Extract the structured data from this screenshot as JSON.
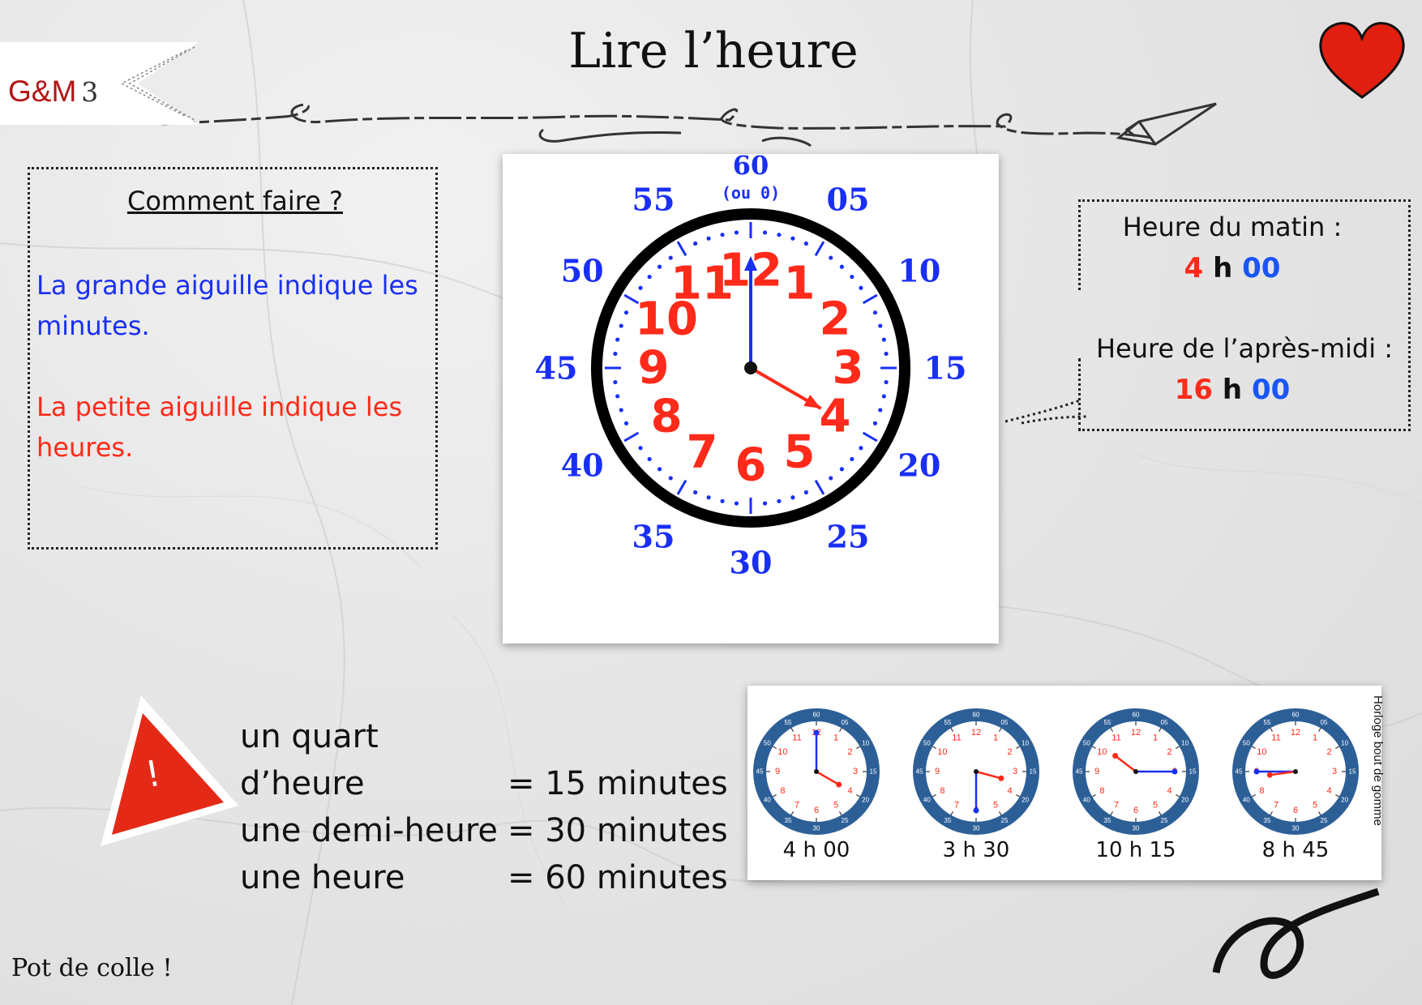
{
  "header": {
    "badge_prefix": "G&M",
    "badge_number": "3",
    "title": "Lire l’heure"
  },
  "howto": {
    "title": "Comment faire ?",
    "minutes_text": "La grande aiguille indique les minutes.",
    "hours_text": "La petite aiguille indique les heures."
  },
  "main_clock": {
    "minute_labels": [
      "05",
      "10",
      "15",
      "20",
      "25",
      "30",
      "35",
      "40",
      "45",
      "50",
      "55"
    ],
    "top_label": "60",
    "top_sub_label": "(ou 0)",
    "hour_labels": [
      "12",
      "1",
      "2",
      "3",
      "4",
      "5",
      "6",
      "7",
      "8",
      "9",
      "10",
      "11"
    ],
    "hour_hand": 4,
    "minute_hand": 0
  },
  "hours_box": {
    "morning_label": "Heure du matin :",
    "morning_hour": "4",
    "morning_sep": "h",
    "morning_min": "00",
    "afternoon_label": "Heure de l’après-midi :",
    "afternoon_hour": "16",
    "afternoon_sep": "h",
    "afternoon_min": "00"
  },
  "warning": {
    "symbol": "!",
    "rows": [
      {
        "left": "un quart d’heure",
        "right": "= 15 minutes"
      },
      {
        "left": "une demi-heure",
        "right": "= 30 minutes"
      },
      {
        "left": "une heure",
        "right": "= 60 minutes"
      }
    ]
  },
  "examples": {
    "credit": "Horloge bout de gomme",
    "clocks": [
      {
        "label": "4 h 00",
        "hour": 4,
        "minute": 0
      },
      {
        "label": "3 h 30",
        "hour": 3.5,
        "minute": 30
      },
      {
        "label": "10 h 15",
        "hour": 10.25,
        "minute": 15
      },
      {
        "label": "8 h 45",
        "hour": 8.75,
        "minute": 45
      }
    ]
  },
  "footer": {
    "text": "Pot de colle !"
  },
  "colors": {
    "red": "#ff2a1a",
    "blue": "#1a2ff5",
    "ring": "#2d5f97"
  }
}
